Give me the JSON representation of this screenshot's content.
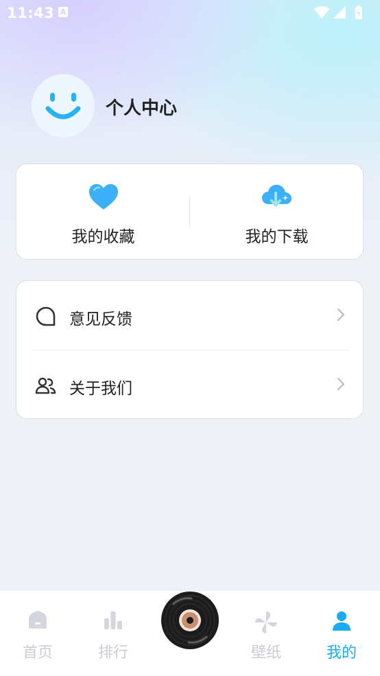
{
  "status_bar": {
    "time": "11:43",
    "notification_glyph": "A"
  },
  "profile": {
    "title": "个人中心"
  },
  "quick_actions": [
    {
      "label": "我的收藏",
      "icon": "heart-icon",
      "color": "#3bb0f6"
    },
    {
      "label": "我的下载",
      "icon": "cloud-download-icon",
      "color": "#3bb0f6"
    }
  ],
  "menu": [
    {
      "label": "意见反馈",
      "icon": "feedback-chat-icon"
    },
    {
      "label": "关于我们",
      "icon": "users-icon"
    }
  ],
  "bottom_nav": {
    "items": [
      {
        "label": "首页",
        "icon": "home-icon",
        "active": false
      },
      {
        "label": "排行",
        "icon": "bar-chart-icon",
        "active": false
      },
      {
        "label": "壁纸",
        "icon": "pinwheel-icon",
        "active": false
      },
      {
        "label": "我的",
        "icon": "person-icon",
        "active": true
      }
    ],
    "center_button": "vinyl-disc-icon"
  },
  "colors": {
    "accent": "#1aabf0",
    "inactive": "#c9ccd3",
    "text": "#222222"
  }
}
